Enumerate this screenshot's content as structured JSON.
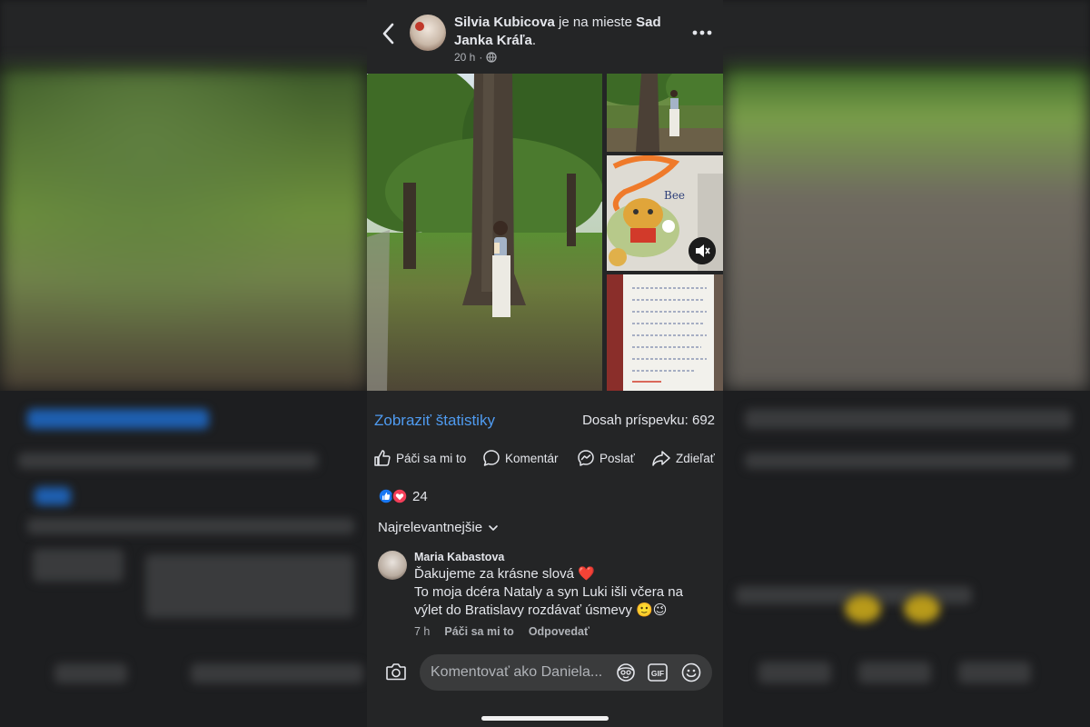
{
  "post": {
    "author": "Silvia Kubicova",
    "location_connector": " je na mieste ",
    "location": "Sad Janka Kráľa",
    "location_suffix": ".",
    "time": "20 h",
    "time_separator": "·",
    "privacy_icon": "globe-icon"
  },
  "insights": {
    "stats_link": "Zobraziť štatistiky",
    "reach": "Dosah príspevku: 692"
  },
  "actions": {
    "like": "Páči sa mi to",
    "comment": "Komentár",
    "send": "Poslať",
    "share": "Zdieľať"
  },
  "reactions": {
    "count": "24",
    "types": [
      "like",
      "love"
    ]
  },
  "comments_sort": "Najrelevantnejšie",
  "comment": {
    "author": "Maria Kabastova",
    "line1": "Ďakujeme za krásne slová ❤️",
    "line2": "To moja dcéra Nataly a syn Luki išli včera na výlet do Bratislavy rozdávať úsmevy 🙂😉",
    "time": "7 h",
    "like": "Páči sa mi to",
    "reply": "Odpovedať"
  },
  "composer": {
    "placeholder": "Komentovať ako Daniela..."
  },
  "colors": {
    "accent": "#4f9bf0",
    "like": "#1877f2",
    "love": "#f33e58",
    "surface": "#242526"
  }
}
